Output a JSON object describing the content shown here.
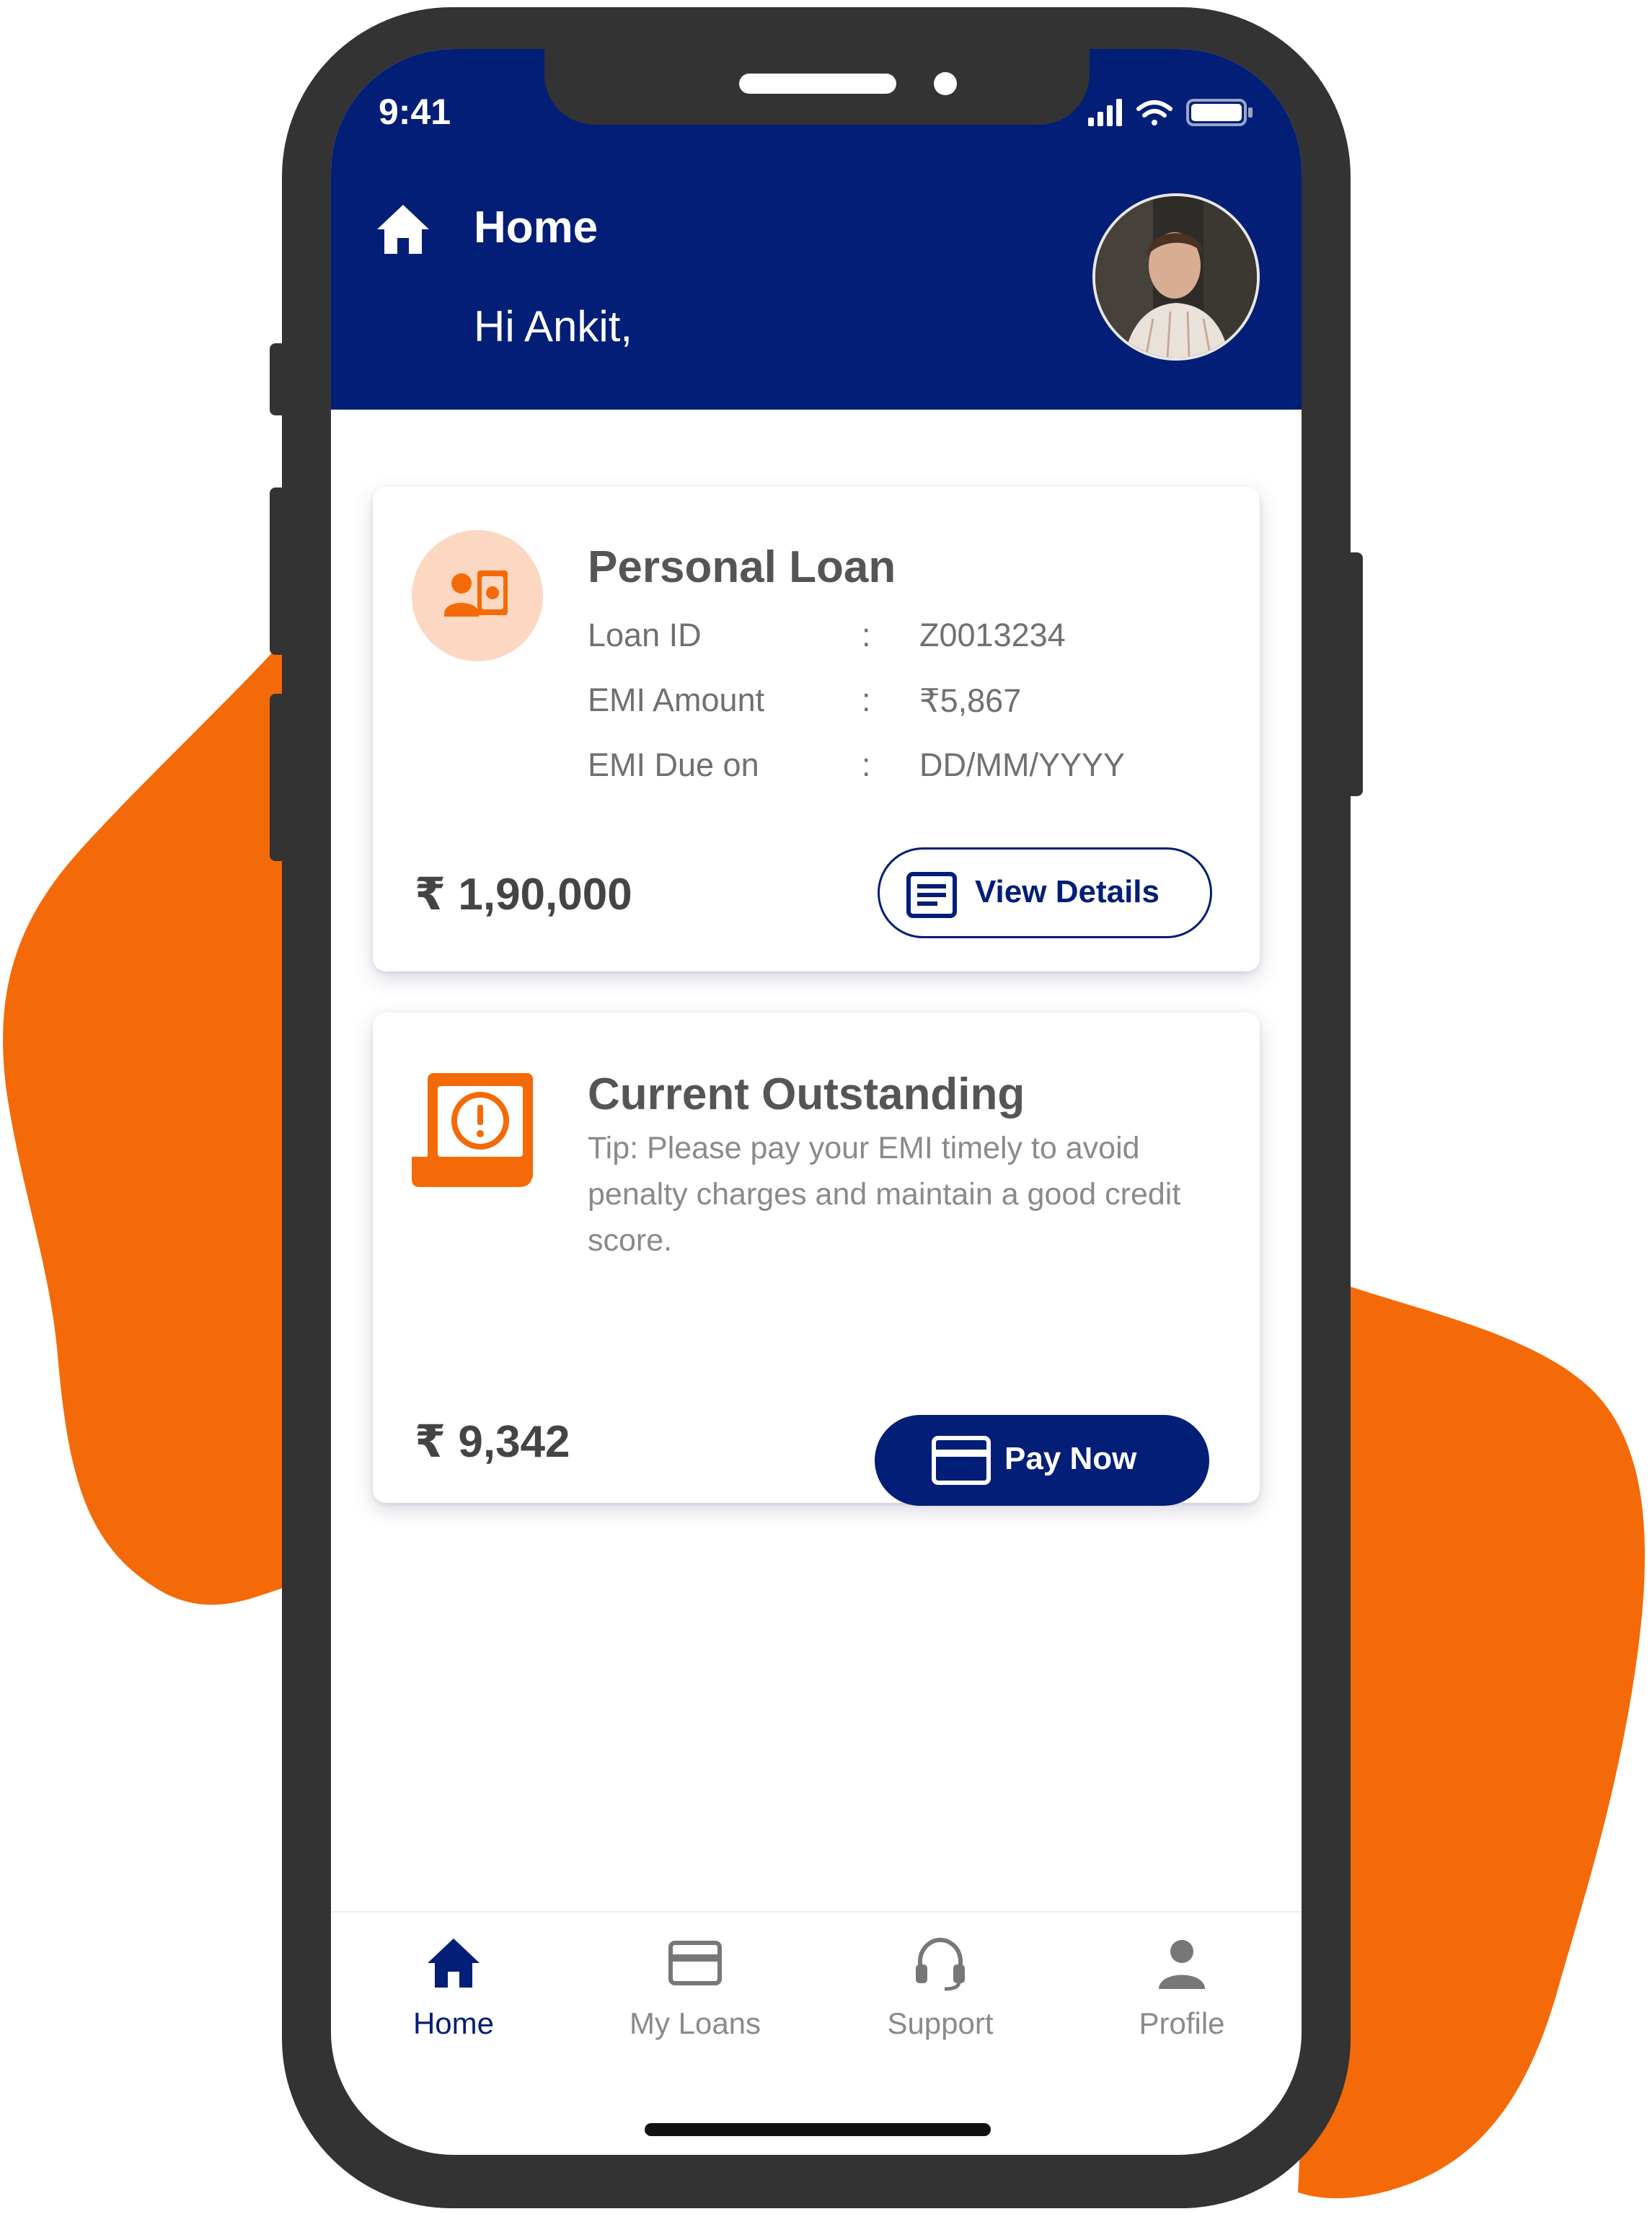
{
  "colors": {
    "primary": "#021e76",
    "accent_orange": "#f46a08",
    "accent_orange_light": "#fcd8c2",
    "phone_frame": "#333333"
  },
  "status_bar": {
    "time": "9:41",
    "icons": [
      "signal-icon",
      "wifi-icon",
      "battery-icon"
    ]
  },
  "header": {
    "icon": "home-icon",
    "title": "Home",
    "greeting": "Hi Ankit,",
    "avatar": "user-avatar-photo"
  },
  "loan_card": {
    "icon": "loan-icon",
    "title": "Personal Loan",
    "details": [
      {
        "label": "Loan ID",
        "separator": ":",
        "value": "Z0013234"
      },
      {
        "label": "EMI Amount",
        "separator": ":",
        "value": "₹5,867"
      },
      {
        "label": "EMI Due on",
        "separator": ":",
        "value": "DD/MM/YYYY"
      }
    ],
    "amount": "₹ 1,90,000",
    "button_label": "View Details",
    "button_icon": "document-list-icon"
  },
  "outstanding_card": {
    "icon": "alert-scroll-icon",
    "title": "Current Outstanding",
    "tip": "Tip: Please pay your EMI timely to avoid penalty charges and maintain a good credit score.",
    "amount": "₹ 9,342",
    "button_label": "Pay Now",
    "button_icon": "card-icon"
  },
  "bottom_nav": {
    "items": [
      {
        "label": "Home",
        "icon": "home-icon",
        "active": true
      },
      {
        "label": "My Loans",
        "icon": "card-icon",
        "active": false
      },
      {
        "label": "Support",
        "icon": "headset-icon",
        "active": false
      },
      {
        "label": "Profile",
        "icon": "person-icon",
        "active": false
      }
    ]
  }
}
